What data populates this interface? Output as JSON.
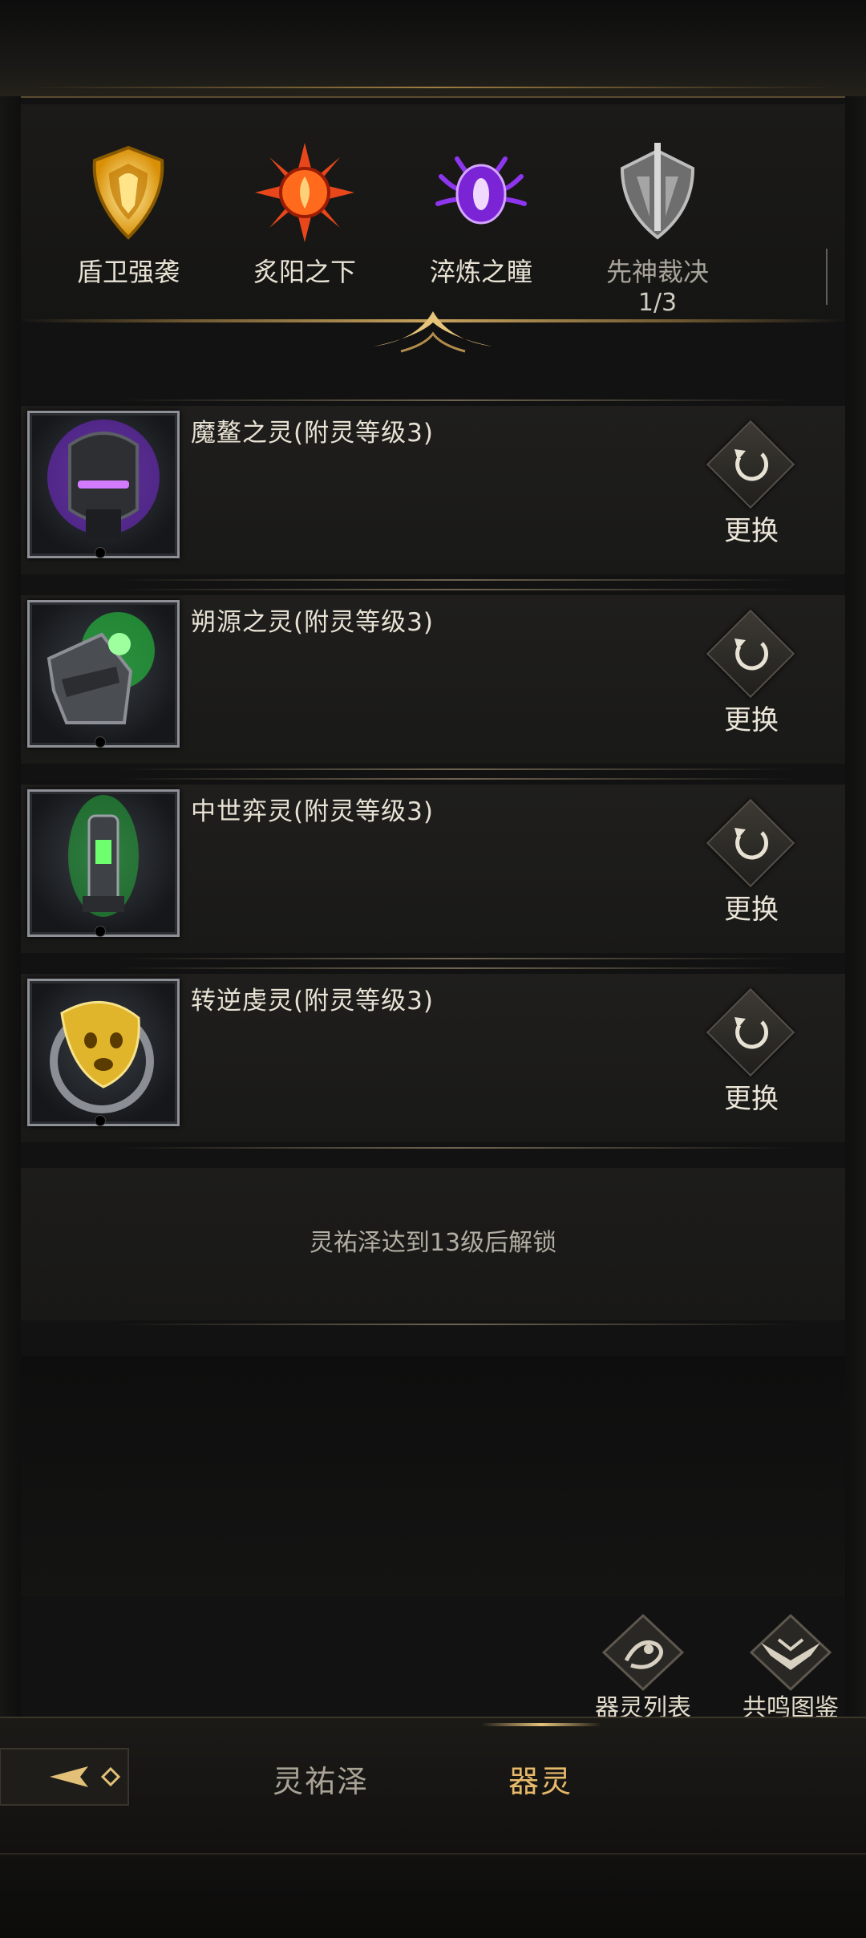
{
  "categories": [
    {
      "label": "盾卫强袭",
      "sub": "",
      "emblem": "golden-shield-emblem",
      "color": "#f2b31b"
    },
    {
      "label": "炙阳之下",
      "sub": "",
      "emblem": "red-sun-emblem",
      "color": "#e8471b"
    },
    {
      "label": "淬炼之瞳",
      "sub": "",
      "emblem": "purple-eye-emblem",
      "color": "#9a3cf0"
    },
    {
      "label": "先神裁决",
      "sub": "1/3",
      "emblem": "silver-blade-emblem",
      "color": "#9a9a9a"
    }
  ],
  "slots": [
    {
      "name": "魔鳌之灵(附灵等级3)",
      "icon": "dark-helmet-purple-flame-icon",
      "glow": "#9a3cf0",
      "action": "更换"
    },
    {
      "name": "朔源之灵(附灵等级3)",
      "icon": "armored-gauntlet-green-spirit-icon",
      "glow": "#33d04a",
      "action": "更换"
    },
    {
      "name": "中世弈灵(附灵等级3)",
      "icon": "green-chess-tower-icon",
      "glow": "#33d04a",
      "action": "更换"
    },
    {
      "name": "转逆虔灵(附灵等级3)",
      "icon": "golden-spirit-mask-icon",
      "glow": "#e8c24a",
      "action": "更换"
    }
  ],
  "locked_slot": {
    "text": "灵祐泽达到13级后解锁"
  },
  "actions": [
    {
      "label": "器灵列表",
      "icon": "spirit-list-icon"
    },
    {
      "label": "共鸣图鉴",
      "icon": "winged-codex-icon"
    }
  ],
  "nav": {
    "tabs": [
      {
        "label": "灵祐泽",
        "active": false
      },
      {
        "label": "器灵",
        "active": true
      }
    ],
    "accent_color": "#e7b96a"
  }
}
